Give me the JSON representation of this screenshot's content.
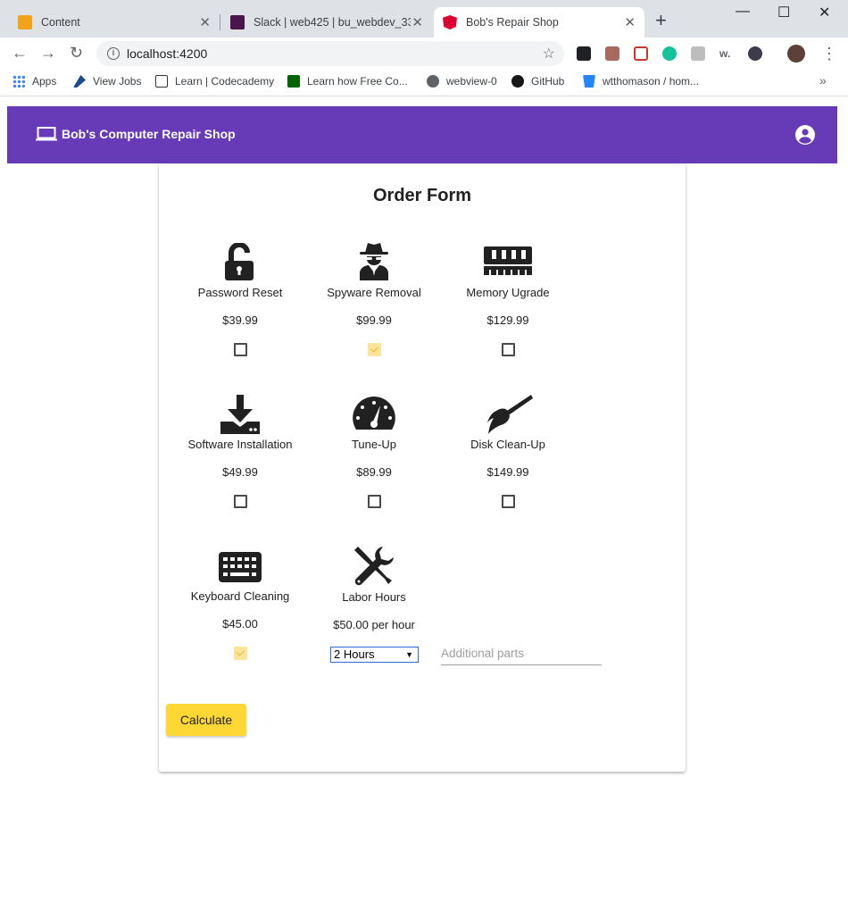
{
  "browser": {
    "tabs": [
      {
        "title": "Content"
      },
      {
        "title": "Slack | web425 | bu_webdev_339"
      },
      {
        "title": "Bob's Repair Shop"
      }
    ],
    "url": "localhost:4200",
    "bookmarks": [
      {
        "label": "Apps"
      },
      {
        "label": "View Jobs"
      },
      {
        "label": "Learn | Codecademy"
      },
      {
        "label": "Learn how Free Co..."
      },
      {
        "label": "webview-0"
      },
      {
        "label": "GitHub"
      },
      {
        "label": "wtthomason / hom..."
      }
    ]
  },
  "app": {
    "title": "Bob's Computer Repair Shop",
    "accent_color": "#673ab7",
    "button_color": "#fdd835"
  },
  "form": {
    "title": "Order Form",
    "services": [
      {
        "name": "Password Reset",
        "price": "$39.99",
        "icon": "lock-open-icon",
        "checked": false
      },
      {
        "name": "Spyware Removal",
        "price": "$99.99",
        "icon": "spy-icon",
        "checked": true
      },
      {
        "name": "Memory Ugrade",
        "price": "$129.99",
        "icon": "memory-icon",
        "checked": false
      },
      {
        "name": "Software Installation",
        "price": "$49.99",
        "icon": "download-icon",
        "checked": false
      },
      {
        "name": "Tune-Up",
        "price": "$89.99",
        "icon": "speedometer-icon",
        "checked": false
      },
      {
        "name": "Disk Clean-Up",
        "price": "$149.99",
        "icon": "brush-icon",
        "checked": false
      },
      {
        "name": "Keyboard Cleaning",
        "price": "$45.00",
        "icon": "keyboard-icon",
        "checked": true
      }
    ],
    "labor": {
      "name": "Labor Hours",
      "price": "$50.00 per hour",
      "icon": "tools-icon",
      "selected_hours": "2 Hours"
    },
    "parts_placeholder": "Additional parts",
    "calculate_label": "Calculate"
  }
}
